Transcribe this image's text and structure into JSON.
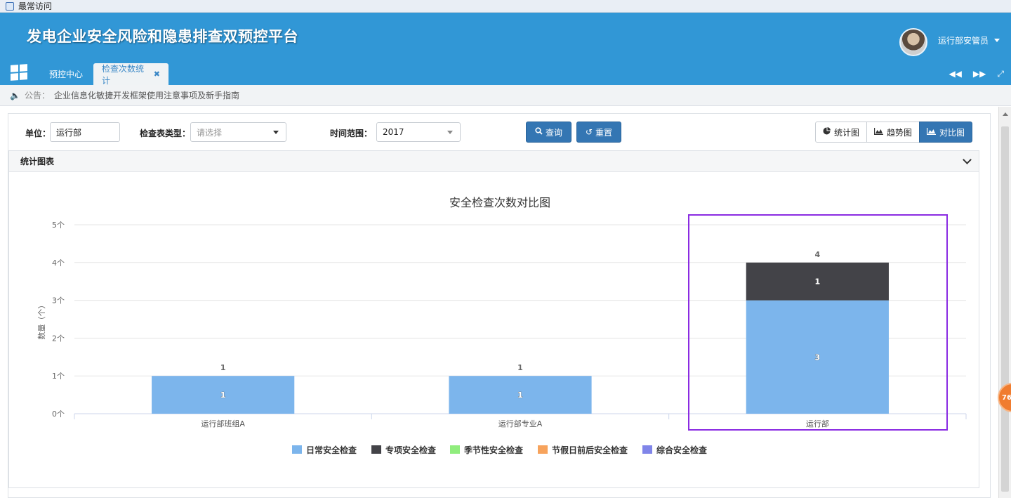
{
  "browser": {
    "title": "最常访问"
  },
  "header": {
    "brand": "发电企业安全风险和隐患排查双预控平台",
    "user": "运行部安管员"
  },
  "tabs": [
    {
      "label": "预控中心"
    },
    {
      "label": "检查次数统计",
      "close": "✖"
    }
  ],
  "notice": {
    "label": "公告：",
    "text": "企业信息化敏捷开发框架使用注意事项及新手指南"
  },
  "filters": {
    "unit_label": "单位：",
    "unit_value": "运行部",
    "type_label": "检查表类型：",
    "type_placeholder": "请选择",
    "time_label": "时间范围：",
    "time_value": "2017",
    "query": "查询",
    "reset": "重置"
  },
  "views": {
    "stat": "统计图",
    "trend": "趋势图",
    "compare": "对比图"
  },
  "box": {
    "title": "统计图表"
  },
  "colors": {
    "accent": "#3197d6",
    "button": "#3476b3",
    "highlight": "#8a2be2"
  },
  "chart_data": {
    "type": "bar",
    "stacked": true,
    "title": "安全检查次数对比图",
    "ylabel": "数量（个）",
    "ylim": [
      0,
      5
    ],
    "yticks": [
      "0个",
      "1个",
      "2个",
      "3个",
      "4个",
      "5个"
    ],
    "categories": [
      "运行部班组A",
      "运行部专业A",
      "运行部"
    ],
    "series": [
      {
        "name": "日常安全检查",
        "values": [
          1,
          1,
          3
        ],
        "color": "#7cb5ec"
      },
      {
        "name": "专项安全检查",
        "values": [
          0,
          0,
          1
        ],
        "color": "#434348"
      },
      {
        "name": "季节性安全检查",
        "values": [
          0,
          0,
          0
        ],
        "color": "#90ed7d"
      },
      {
        "name": "节假日前后安全检查",
        "values": [
          0,
          0,
          0
        ],
        "color": "#f7a35c"
      },
      {
        "name": "综合安全检查",
        "values": [
          0,
          0,
          0
        ],
        "color": "#8085e9"
      }
    ],
    "totals": [
      1,
      1,
      4
    ],
    "grid": true,
    "legend": "bottom",
    "highlighted_category": "运行部"
  }
}
